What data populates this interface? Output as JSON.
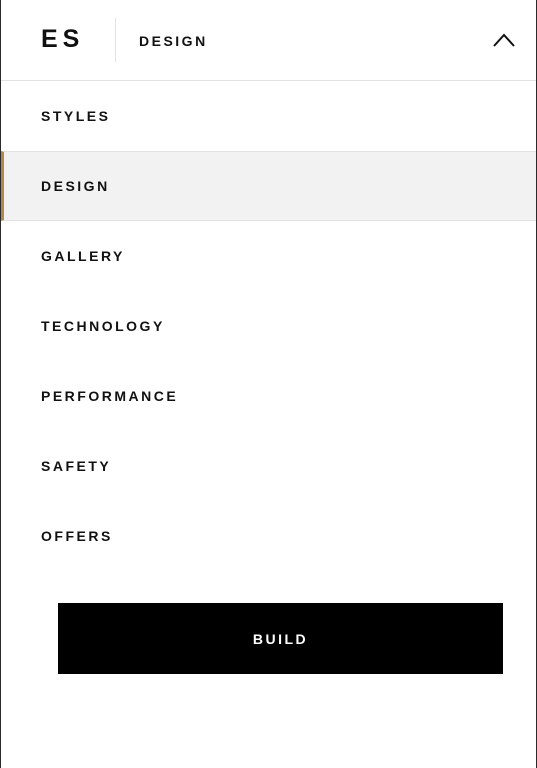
{
  "header": {
    "logo_text": "ES",
    "section_title": "DESIGN",
    "toggle_icon": "chevron-up-icon"
  },
  "nav": {
    "items": [
      {
        "label": "STYLES",
        "active": false
      },
      {
        "label": "DESIGN",
        "active": true
      },
      {
        "label": "GALLERY",
        "active": false
      },
      {
        "label": "TECHNOLOGY",
        "active": false
      },
      {
        "label": "PERFORMANCE",
        "active": false
      },
      {
        "label": "SAFETY",
        "active": false
      },
      {
        "label": "OFFERS",
        "active": false
      }
    ]
  },
  "cta": {
    "build_label": "BUILD"
  },
  "colors": {
    "accent": "#b08a4c",
    "active_background": "#f2f2f2",
    "button_background": "#000000",
    "button_text": "#ffffff",
    "text": "#111111",
    "divider": "#e2e2e2"
  }
}
